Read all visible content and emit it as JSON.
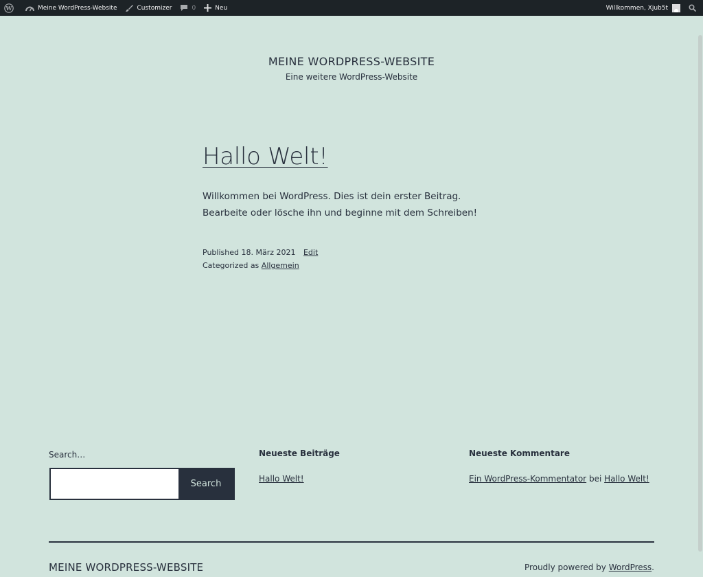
{
  "adminbar": {
    "site_name": "Meine WordPress-Website",
    "customizer": "Customizer",
    "comments_count": "0",
    "new_label": "Neu",
    "welcome": "Willkommen, Xjub5t"
  },
  "header": {
    "site_title": "MEINE WORDPRESS-WEBSITE",
    "tagline": "Eine weitere WordPress-Website"
  },
  "post": {
    "title": "Hallo Welt!",
    "body": "Willkommen bei WordPress. Dies ist dein erster Beitrag. Bearbeite oder lösche ihn und beginne mit dem Schreiben!",
    "published_label": "Published",
    "date": "18. März 2021",
    "edit_label": "Edit",
    "categorized_label": "Categorized as",
    "category": "Allgemein"
  },
  "widgets": {
    "search": {
      "label": "Search…",
      "value": "",
      "button": "Search"
    },
    "recent_posts": {
      "heading": "Neueste Beiträge",
      "items": [
        "Hallo Welt!"
      ]
    },
    "recent_comments": {
      "heading": "Neueste Kommentare",
      "author": "Ein WordPress-Kommentator",
      "connector": "bei",
      "post": "Hallo Welt!"
    }
  },
  "footer": {
    "site_title": "MEINE WORDPRESS-WEBSITE",
    "powered_prefix": "Proudly powered by",
    "powered_link": "WordPress",
    "powered_suffix": "."
  },
  "colors": {
    "background": "#d1e4dd",
    "text": "#28303d",
    "adminbar": "#1d2327"
  }
}
